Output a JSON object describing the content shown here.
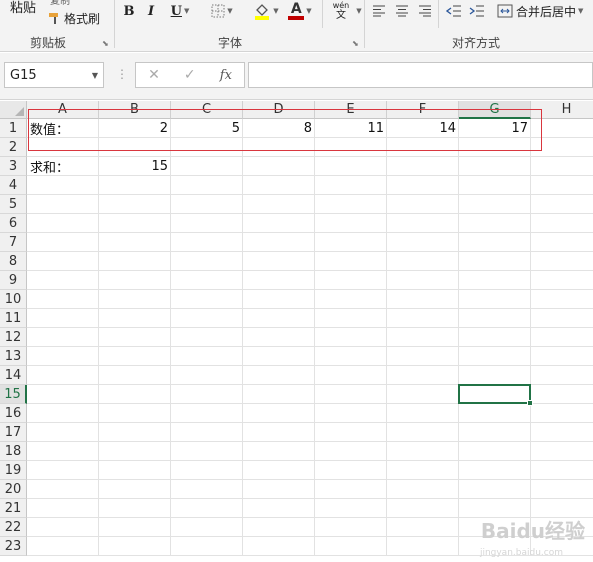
{
  "ribbon": {
    "clipboard": {
      "paste_label": "粘贴",
      "copy_label": "复制",
      "format_painter_label": "格式刷",
      "group_label": "剪贴板"
    },
    "font": {
      "bold": "B",
      "italic": "I",
      "underline": "U",
      "font_color_glyph": "A",
      "phonetic_top": "wén",
      "phonetic_bottom": "文",
      "group_label": "字体",
      "font_color": "#c00000",
      "fill_color": "#ffff00"
    },
    "alignment": {
      "merge_center_label": "合并后居中",
      "group_label": "对齐方式"
    }
  },
  "formula_bar": {
    "name_box_value": "G15",
    "formula_value": ""
  },
  "sheet": {
    "columns": [
      "A",
      "B",
      "C",
      "D",
      "E",
      "F",
      "G",
      "H"
    ],
    "rows": [
      "1",
      "2",
      "3",
      "4",
      "5",
      "6",
      "7",
      "8",
      "9",
      "10",
      "11",
      "12",
      "13",
      "14",
      "15",
      "16",
      "17",
      "18",
      "19",
      "20",
      "21",
      "22",
      "23"
    ],
    "selected_cell": "G15",
    "cells": {
      "A1": "数值：",
      "B1": "2",
      "C1": "5",
      "D1": "8",
      "E1": "11",
      "F1": "14",
      "G1": "17",
      "A3": "求和：",
      "B3": "15"
    },
    "highlight_box_color": "#d9363e",
    "selection_color": "#217346"
  },
  "watermark": {
    "text": "Baidu经验",
    "sub": "jingyan.baidu.com"
  }
}
